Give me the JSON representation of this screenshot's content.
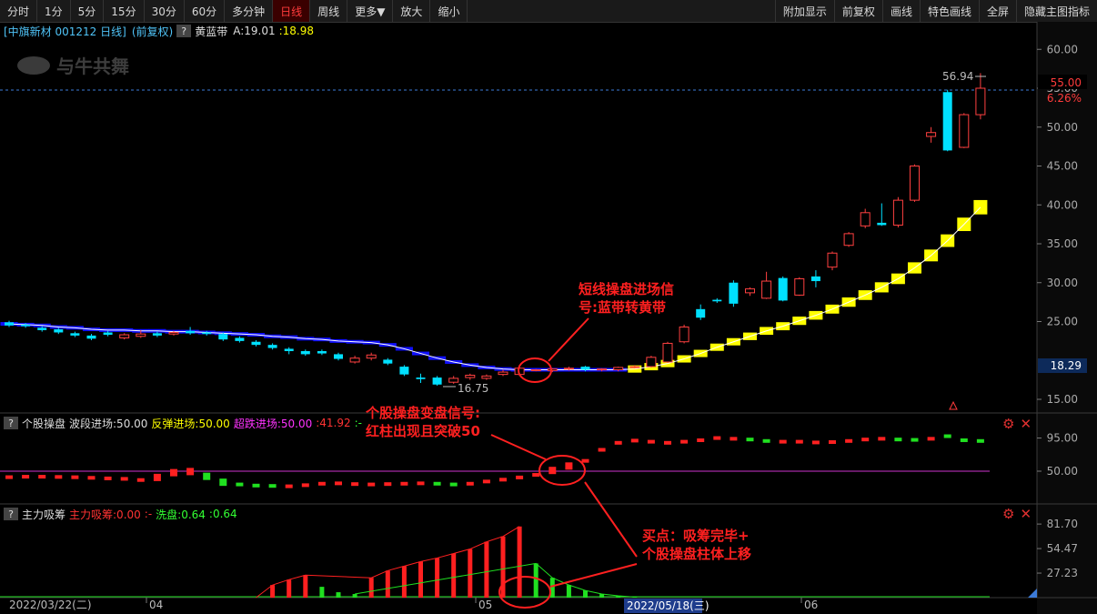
{
  "toolbar": {
    "left": [
      "分时",
      "1分",
      "5分",
      "15分",
      "30分",
      "60分",
      "多分钟",
      "日线",
      "周线",
      "更多▼",
      "放大",
      "缩小"
    ],
    "active": "日线",
    "right": [
      "附加显示",
      "前复权",
      "画线",
      "特色画线",
      "全屏",
      "隐藏主图指标"
    ]
  },
  "main_info": {
    "stock": "[中旗新材 001212 日线]",
    "adj": "(前复权)",
    "indicator": "黄蓝带",
    "a_label": "A:19.01",
    "a_value": ":18.98"
  },
  "watermark": "与牛共舞",
  "main_axis": {
    "ticks": [
      "60.00",
      "55.00",
      "50.00",
      "45.00",
      "40.00",
      "35.00",
      "30.00",
      "25.00",
      "15.00"
    ],
    "current_price": "55.00",
    "current_pct": "6.26%",
    "crosshair_price": "18.29"
  },
  "marks": {
    "high": "56.94",
    "low": "16.75"
  },
  "annotations": {
    "a1_line1": "短线操盘进场信",
    "a1_line2": "号:蓝带转黄带",
    "a2_line1": "个股操盘变盘信号:",
    "a2_line2": "红柱出现且突破50",
    "a3_line1": "买点：吸筹完毕+",
    "a3_line2": "个股操盘柱体上移"
  },
  "pane2_info": {
    "name": "个股操盘",
    "s1": "波段进场:50.00",
    "s2": "反弹进场:50.00",
    "s3": "超跌进场:50.00",
    "s4": ":41.92",
    "s5": ":-"
  },
  "pane2_axis": [
    "95.00",
    "50.00"
  ],
  "pane3_info": {
    "name": "主力吸筹",
    "s1": "主力吸筹:0.00",
    "s2": ":-",
    "s3": "洗盘:0.64",
    "s4": ":0.64"
  },
  "pane3_axis": [
    "81.70",
    "54.47",
    "27.23"
  ],
  "date_axis": {
    "start": "2022/03/22(二)",
    "m1": "04",
    "m2": "05",
    "cursor": "2022/05/18(三)",
    "m3": "06"
  },
  "chart_data": {
    "type": "candlestick",
    "candles": [
      {
        "o": 24.9,
        "c": 24.5,
        "h": 25.1,
        "l": 24.3
      },
      {
        "o": 24.6,
        "c": 24.4,
        "h": 24.8,
        "l": 24.2
      },
      {
        "o": 24.2,
        "c": 23.9,
        "h": 24.4,
        "l": 23.7
      },
      {
        "o": 24.0,
        "c": 23.6,
        "h": 24.2,
        "l": 23.4
      },
      {
        "o": 23.5,
        "c": 23.2,
        "h": 23.7,
        "l": 23.0
      },
      {
        "o": 23.2,
        "c": 22.8,
        "h": 23.4,
        "l": 22.6
      },
      {
        "o": 23.6,
        "c": 23.3,
        "h": 23.8,
        "l": 23.1
      },
      {
        "o": 22.9,
        "c": 23.3,
        "h": 23.5,
        "l": 22.7
      },
      {
        "o": 23.1,
        "c": 23.4,
        "h": 23.9,
        "l": 22.9
      },
      {
        "o": 23.5,
        "c": 23.2,
        "h": 23.7,
        "l": 23.0
      },
      {
        "o": 23.4,
        "c": 23.6,
        "h": 23.8,
        "l": 23.2
      },
      {
        "o": 23.8,
        "c": 23.5,
        "h": 24.3,
        "l": 23.3
      },
      {
        "o": 23.6,
        "c": 23.4,
        "h": 23.8,
        "l": 23.2
      },
      {
        "o": 23.4,
        "c": 22.7,
        "h": 23.6,
        "l": 22.5
      },
      {
        "o": 22.9,
        "c": 22.5,
        "h": 23.1,
        "l": 22.3
      },
      {
        "o": 22.4,
        "c": 22.0,
        "h": 22.6,
        "l": 21.8
      },
      {
        "o": 22.0,
        "c": 21.6,
        "h": 22.2,
        "l": 21.4
      },
      {
        "o": 21.5,
        "c": 21.2,
        "h": 21.7,
        "l": 20.8
      },
      {
        "o": 21.2,
        "c": 20.8,
        "h": 21.4,
        "l": 20.6
      },
      {
        "o": 21.2,
        "c": 20.9,
        "h": 21.4,
        "l": 20.7
      },
      {
        "o": 20.8,
        "c": 20.2,
        "h": 21.0,
        "l": 20.0
      },
      {
        "o": 19.8,
        "c": 20.3,
        "h": 20.6,
        "l": 19.6
      },
      {
        "o": 20.3,
        "c": 20.7,
        "h": 21.0,
        "l": 20.0
      },
      {
        "o": 20.1,
        "c": 19.6,
        "h": 20.3,
        "l": 19.4
      },
      {
        "o": 19.2,
        "c": 18.2,
        "h": 19.4,
        "l": 18.0
      },
      {
        "o": 17.8,
        "c": 17.6,
        "h": 18.3,
        "l": 17.1
      },
      {
        "o": 17.8,
        "c": 16.9,
        "h": 18.0,
        "l": 16.75
      },
      {
        "o": 17.2,
        "c": 17.7,
        "h": 18.0,
        "l": 17.0
      },
      {
        "o": 17.8,
        "c": 18.1,
        "h": 18.3,
        "l": 17.5
      },
      {
        "o": 17.7,
        "c": 18.0,
        "h": 18.2,
        "l": 17.5
      },
      {
        "o": 18.2,
        "c": 18.5,
        "h": 18.8,
        "l": 18.0
      },
      {
        "o": 18.2,
        "c": 19.0,
        "h": 19.2,
        "l": 18.0
      },
      {
        "o": 18.7,
        "c": 18.8,
        "h": 18.9,
        "l": 18.6
      },
      {
        "o": 18.7,
        "c": 18.9,
        "h": 19.0,
        "l": 18.5
      },
      {
        "o": 18.9,
        "c": 19.0,
        "h": 19.2,
        "l": 18.7
      },
      {
        "o": 19.2,
        "c": 18.8,
        "h": 19.3,
        "l": 18.6
      },
      {
        "o": 18.8,
        "c": 18.9,
        "h": 19.0,
        "l": 18.6
      },
      {
        "o": 18.8,
        "c": 19.1,
        "h": 19.2,
        "l": 18.6
      },
      {
        "o": 19.1,
        "c": 19.2,
        "h": 19.4,
        "l": 19.0
      },
      {
        "o": 19.2,
        "c": 20.4,
        "h": 20.6,
        "l": 19.1
      },
      {
        "o": 19.8,
        "c": 22.2,
        "h": 22.4,
        "l": 19.7
      },
      {
        "o": 22.4,
        "c": 24.3,
        "h": 24.6,
        "l": 22.2
      },
      {
        "o": 26.6,
        "c": 25.5,
        "h": 27.2,
        "l": 25.2
      },
      {
        "o": 27.8,
        "c": 27.6,
        "h": 28.0,
        "l": 27.4
      },
      {
        "o": 30.0,
        "c": 27.3,
        "h": 30.3,
        "l": 26.9
      },
      {
        "o": 28.7,
        "c": 29.2,
        "h": 29.4,
        "l": 28.3
      },
      {
        "o": 28.0,
        "c": 30.2,
        "h": 31.4,
        "l": 27.9
      },
      {
        "o": 30.6,
        "c": 27.7,
        "h": 30.8,
        "l": 27.6
      },
      {
        "o": 28.4,
        "c": 30.5,
        "h": 30.7,
        "l": 28.3
      },
      {
        "o": 30.8,
        "c": 30.2,
        "h": 31.6,
        "l": 29.4
      },
      {
        "o": 32.0,
        "c": 33.8,
        "h": 34.0,
        "l": 31.6
      },
      {
        "o": 34.8,
        "c": 36.3,
        "h": 36.5,
        "l": 34.6
      },
      {
        "o": 37.3,
        "c": 39.0,
        "h": 39.5,
        "l": 37.0
      },
      {
        "o": 37.7,
        "c": 37.4,
        "h": 40.2,
        "l": 37.3
      },
      {
        "o": 37.4,
        "c": 40.6,
        "h": 41.0,
        "l": 37.1
      },
      {
        "o": 40.6,
        "c": 45.0,
        "h": 45.2,
        "l": 40.4
      },
      {
        "o": 48.8,
        "c": 49.3,
        "h": 50.0,
        "l": 48.0
      },
      {
        "o": 54.5,
        "c": 47.0,
        "h": 54.8,
        "l": 46.9
      },
      {
        "o": 47.4,
        "c": 51.6,
        "h": 51.8,
        "l": 47.3
      },
      {
        "o": 51.6,
        "c": 55.0,
        "h": 56.94,
        "l": 51.0
      }
    ],
    "band": [
      24.7,
      24.6,
      24.5,
      24.3,
      24.2,
      24.0,
      23.9,
      23.9,
      23.8,
      23.8,
      23.7,
      23.7,
      23.6,
      23.5,
      23.4,
      23.3,
      23.1,
      23.0,
      22.8,
      22.7,
      22.5,
      22.4,
      22.3,
      22.0,
      21.5,
      20.9,
      20.3,
      19.8,
      19.4,
      19.1,
      18.9,
      18.8,
      18.8,
      18.8,
      18.8,
      18.8,
      18.8,
      18.8,
      18.9,
      19.2,
      19.6,
      20.2,
      20.9,
      21.7,
      22.4,
      23.1,
      23.8,
      24.4,
      25.1,
      25.8,
      26.6,
      27.5,
      28.4,
      29.4,
      30.5,
      31.9,
      33.5,
      35.4,
      37.5,
      39.7
    ],
    "band_blue_until": 38,
    "pane2_bars": [
      {
        "v": 41.9,
        "c": "r"
      },
      {
        "v": 42.5,
        "c": "r"
      },
      {
        "v": 42.5,
        "c": "r"
      },
      {
        "v": 42.2,
        "c": "r"
      },
      {
        "v": 41.8,
        "c": "r"
      },
      {
        "v": 41.0,
        "c": "r"
      },
      {
        "v": 40.2,
        "c": "r"
      },
      {
        "v": 39.6,
        "c": "r"
      },
      {
        "v": 38.0,
        "c": "r"
      },
      {
        "v": 41.5,
        "c": "r"
      },
      {
        "v": 48.0,
        "c": "r"
      },
      {
        "v": 49.5,
        "c": "r"
      },
      {
        "v": 43.0,
        "c": "g"
      },
      {
        "v": 35.0,
        "c": "g"
      },
      {
        "v": 32.0,
        "c": "g"
      },
      {
        "v": 30.5,
        "c": "g"
      },
      {
        "v": 30.0,
        "c": "g"
      },
      {
        "v": 29.5,
        "c": "r"
      },
      {
        "v": 31.0,
        "c": "r"
      },
      {
        "v": 33.0,
        "c": "r"
      },
      {
        "v": 33.5,
        "c": "r"
      },
      {
        "v": 32.5,
        "c": "r"
      },
      {
        "v": 32.0,
        "c": "r"
      },
      {
        "v": 32.5,
        "c": "r"
      },
      {
        "v": 33.0,
        "c": "r"
      },
      {
        "v": 33.5,
        "c": "r"
      },
      {
        "v": 33.0,
        "c": "g"
      },
      {
        "v": 32.0,
        "c": "g"
      },
      {
        "v": 33.0,
        "c": "r"
      },
      {
        "v": 36.0,
        "c": "r"
      },
      {
        "v": 38.5,
        "c": "r"
      },
      {
        "v": 41.5,
        "c": "r"
      },
      {
        "v": 45.0,
        "c": "r"
      },
      {
        "v": 51.0,
        "c": "r"
      },
      {
        "v": 57.0,
        "c": "r"
      },
      {
        "v": 64.0,
        "c": "r"
      },
      {
        "v": 79.0,
        "c": "r"
      },
      {
        "v": 88.5,
        "c": "r"
      },
      {
        "v": 91.5,
        "c": "r"
      },
      {
        "v": 90.0,
        "c": "r"
      },
      {
        "v": 88.5,
        "c": "r"
      },
      {
        "v": 90.0,
        "c": "r"
      },
      {
        "v": 92.0,
        "c": "r"
      },
      {
        "v": 95.0,
        "c": "r"
      },
      {
        "v": 94.0,
        "c": "r"
      },
      {
        "v": 93.0,
        "c": "g"
      },
      {
        "v": 91.0,
        "c": "g"
      },
      {
        "v": 90.0,
        "c": "r"
      },
      {
        "v": 90.0,
        "c": "r"
      },
      {
        "v": 89.0,
        "c": "r"
      },
      {
        "v": 89.5,
        "c": "r"
      },
      {
        "v": 91.0,
        "c": "r"
      },
      {
        "v": 93.0,
        "c": "r"
      },
      {
        "v": 94.0,
        "c": "r"
      },
      {
        "v": 93.0,
        "c": "g"
      },
      {
        "v": 92.5,
        "c": "g"
      },
      {
        "v": 94.0,
        "c": "r"
      },
      {
        "v": 97.5,
        "c": "g"
      },
      {
        "v": 92.0,
        "c": "g"
      },
      {
        "v": 91.0,
        "c": "g"
      }
    ],
    "pane2_line": 50,
    "pane3_bars": [
      {
        "v": 0,
        "c": "r"
      },
      {
        "v": 0,
        "c": "r"
      },
      {
        "v": 0,
        "c": "r"
      },
      {
        "v": 0,
        "c": "r"
      },
      {
        "v": 0,
        "c": "r"
      },
      {
        "v": 0,
        "c": "r"
      },
      {
        "v": 0,
        "c": "r"
      },
      {
        "v": 0,
        "c": "r"
      },
      {
        "v": 0,
        "c": "r"
      },
      {
        "v": 0,
        "c": "r"
      },
      {
        "v": 0,
        "c": "r"
      },
      {
        "v": 0,
        "c": "r"
      },
      {
        "v": 0,
        "c": "r"
      },
      {
        "v": 0,
        "c": "r"
      },
      {
        "v": 0,
        "c": "r"
      },
      {
        "v": 0,
        "c": "r"
      },
      {
        "v": 14,
        "c": "r"
      },
      {
        "v": 20,
        "c": "r"
      },
      {
        "v": 25,
        "c": "r"
      },
      {
        "v": 12,
        "c": "g"
      },
      {
        "v": 6,
        "c": "g"
      },
      {
        "v": 4,
        "c": "g"
      },
      {
        "v": 22,
        "c": "r"
      },
      {
        "v": 30,
        "c": "r"
      },
      {
        "v": 35,
        "c": "r"
      },
      {
        "v": 40,
        "c": "r"
      },
      {
        "v": 44,
        "c": "r"
      },
      {
        "v": 49,
        "c": "r"
      },
      {
        "v": 54,
        "c": "r"
      },
      {
        "v": 62,
        "c": "r"
      },
      {
        "v": 68,
        "c": "r"
      },
      {
        "v": 79,
        "c": "r"
      },
      {
        "v": 38,
        "c": "g"
      },
      {
        "v": 22,
        "c": "g"
      },
      {
        "v": 14,
        "c": "g"
      },
      {
        "v": 8,
        "c": "g"
      },
      {
        "v": 4,
        "c": "g"
      },
      {
        "v": 2,
        "c": "g"
      },
      {
        "v": 0.64,
        "c": "g"
      }
    ],
    "pane3_start_index": 0
  }
}
